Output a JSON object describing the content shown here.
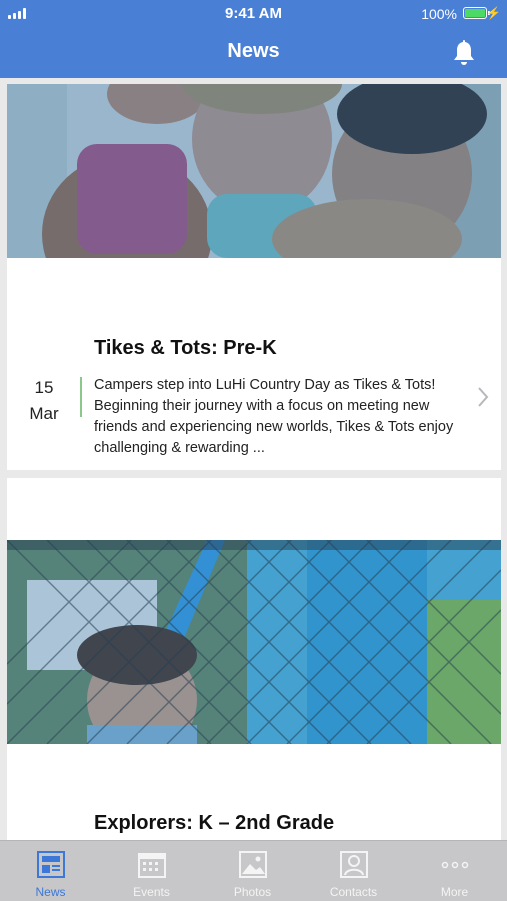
{
  "status_bar": {
    "time": "9:41 AM",
    "battery": "100%"
  },
  "nav": {
    "title": "News"
  },
  "posts": [
    {
      "title": "Tikes & Tots: Pre-K",
      "day": "15",
      "month": "Mar",
      "summary": "Campers step into LuHi Country Day as Tikes & Tots! Beginning their journey with a focus on meeting new friends and experiencing new worlds, Tikes & Tots enjoy challenging & rewarding ..."
    },
    {
      "title": "Explorers: K – 2nd Grade"
    }
  ],
  "tabs": [
    {
      "label": "News",
      "icon": "newspaper-icon",
      "active": true
    },
    {
      "label": "Events",
      "icon": "calendar-icon"
    },
    {
      "label": "Photos",
      "icon": "photo-icon"
    },
    {
      "label": "Contacts",
      "icon": "contact-card-icon"
    },
    {
      "label": "More",
      "icon": "more-dots-icon"
    }
  ],
  "colors": {
    "accent": "#4a7fd6",
    "tab_active": "#3b78d8",
    "date_bar": "#8bc98b",
    "tab_bg": "#c7c7c9"
  }
}
